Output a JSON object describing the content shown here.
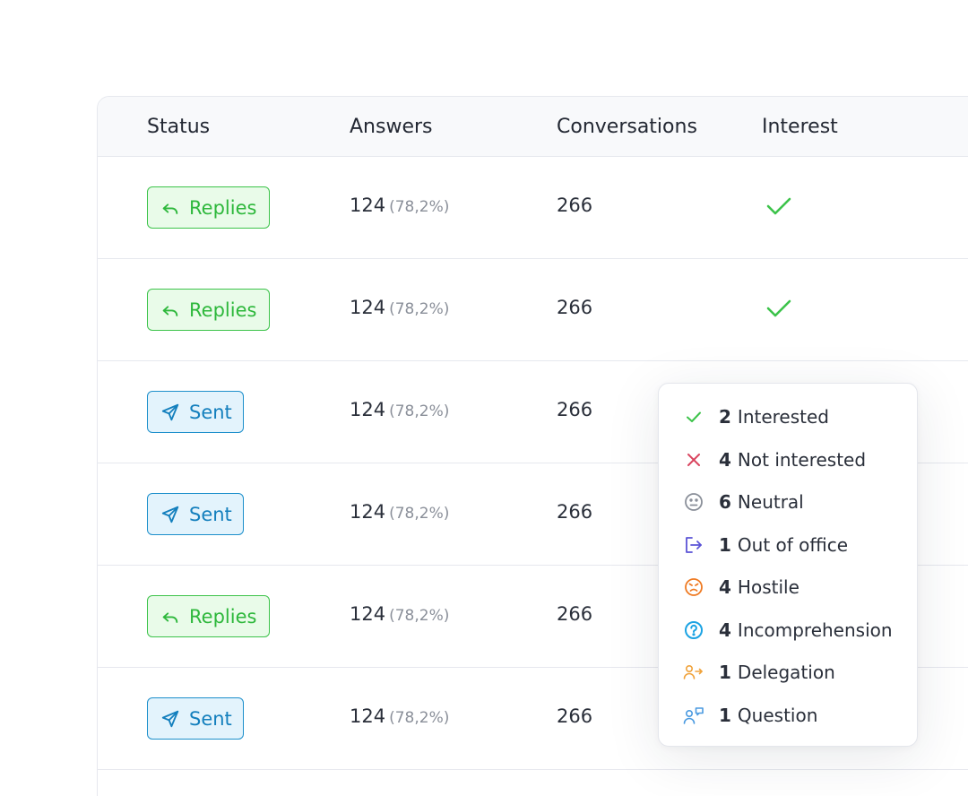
{
  "table": {
    "headers": [
      "Status",
      "Answers",
      "Conversations",
      "Interest"
    ],
    "rows": [
      {
        "status": "Replies",
        "answers": "124",
        "answers_pct": "(78,2%)",
        "conversations": "266",
        "interest": "check"
      },
      {
        "status": "Replies",
        "answers": "124",
        "answers_pct": "(78,2%)",
        "conversations": "266",
        "interest": "check"
      },
      {
        "status": "Sent",
        "answers": "124",
        "answers_pct": "(78,2%)",
        "conversations": "266",
        "interest": ""
      },
      {
        "status": "Sent",
        "answers": "124",
        "answers_pct": "(78,2%)",
        "conversations": "266",
        "interest": ""
      },
      {
        "status": "Replies",
        "answers": "124",
        "answers_pct": "(78,2%)",
        "conversations": "266",
        "interest": ""
      },
      {
        "status": "Sent",
        "answers": "124",
        "answers_pct": "(78,2%)",
        "conversations": "266",
        "interest": ""
      }
    ]
  },
  "popover": {
    "items": [
      {
        "count": "2",
        "label": "Interested",
        "icon": "check-icon",
        "color": "#3cc34a"
      },
      {
        "count": "4",
        "label": "Not interested",
        "icon": "x-icon",
        "color": "#d9455f"
      },
      {
        "count": "6",
        "label": "Neutral",
        "icon": "neutral-face-icon",
        "color": "#8a8f99"
      },
      {
        "count": "1",
        "label": "Out of office",
        "icon": "logout-icon",
        "color": "#5b54d6"
      },
      {
        "count": "4",
        "label": "Hostile",
        "icon": "angry-face-icon",
        "color": "#ef7a22"
      },
      {
        "count": "4",
        "label": "Incomprehension",
        "icon": "question-circle-icon",
        "color": "#1ca3e3"
      },
      {
        "count": "1",
        "label": "Delegation",
        "icon": "user-forward-icon",
        "color": "#f0a23a"
      },
      {
        "count": "1",
        "label": "Question",
        "icon": "user-chat-icon",
        "color": "#4a9ae0"
      }
    ]
  },
  "colors": {
    "replies": "#2eb83c",
    "sent": "#137fbd",
    "interest_check": "#3cc34a"
  }
}
